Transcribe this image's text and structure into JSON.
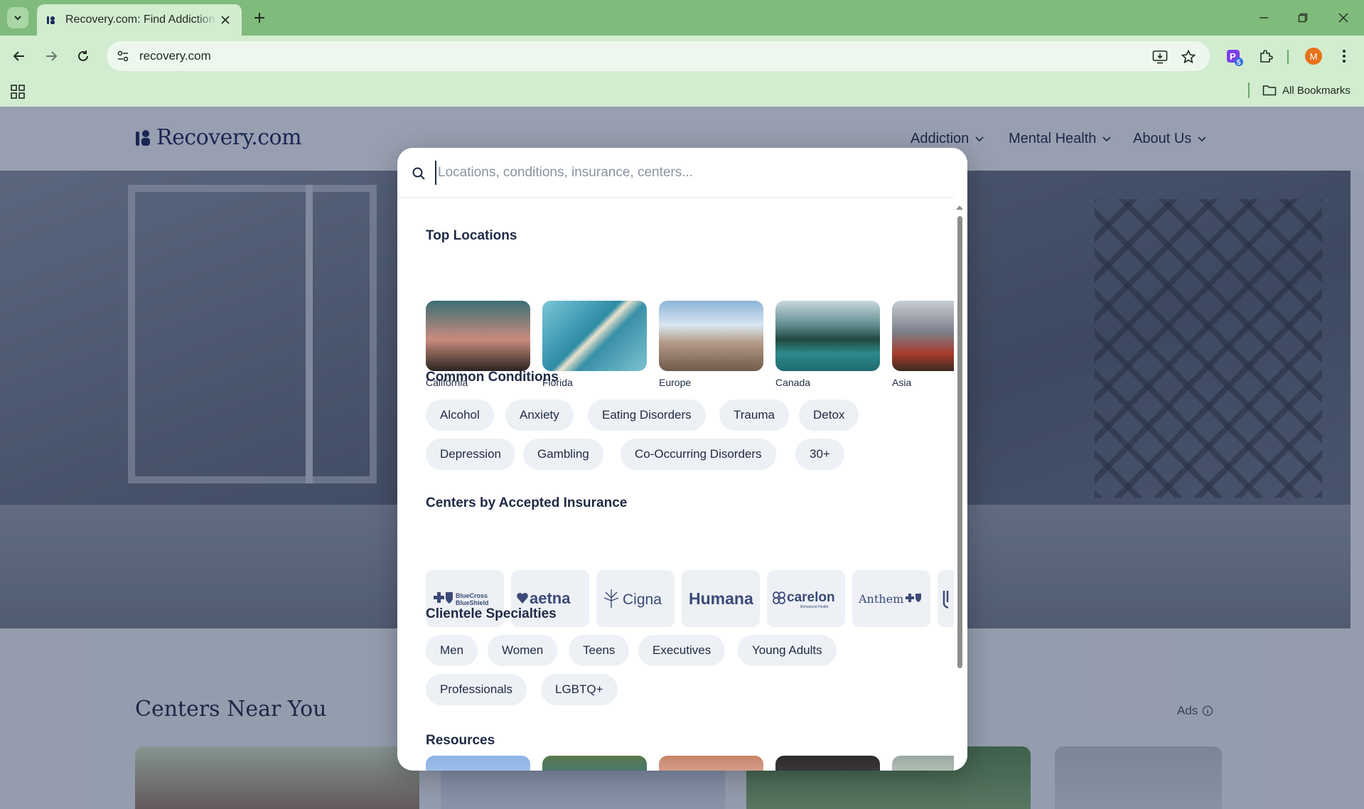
{
  "browser": {
    "tab_title": "Recovery.com: Find Addiction & Mental Health",
    "url": "recovery.com",
    "all_bookmarks_label": "All Bookmarks",
    "profile_initial": "M",
    "extension_badge": "5"
  },
  "site": {
    "logo_text": "Recovery.com",
    "nav": [
      {
        "label": "Addiction"
      },
      {
        "label": "Mental Health"
      },
      {
        "label": "About Us"
      }
    ],
    "centers_title": "Centers Near You",
    "ads_label": "Ads"
  },
  "search": {
    "placeholder": "Locations, conditions, insurance, centers...",
    "value": ""
  },
  "modal": {
    "top_locations_title": "Top Locations",
    "locations": [
      {
        "label": "California"
      },
      {
        "label": "Florida"
      },
      {
        "label": "Europe"
      },
      {
        "label": "Canada"
      },
      {
        "label": "Asia"
      }
    ],
    "conditions_title": "Common Conditions",
    "conditions": [
      "Alcohol",
      "Anxiety",
      "Eating Disorders",
      "Trauma",
      "Detox",
      "Depression",
      "Gambling",
      "Co-Occurring Disorders",
      "30+"
    ],
    "insurance_title": "Centers by Accepted Insurance",
    "insurance": [
      {
        "line1": "BlueCross",
        "line2": "BlueShield"
      },
      {
        "name": "aetna"
      },
      {
        "name": "Cigna"
      },
      {
        "name": "Humana"
      },
      {
        "name": "carelon",
        "sub": "Behavioral Health"
      },
      {
        "name": "Anthem"
      }
    ],
    "clientele_title": "Clientele Specialties",
    "clientele": [
      "Men",
      "Women",
      "Teens",
      "Executives",
      "Young Adults",
      "Professionals",
      "LGBTQ+"
    ],
    "resources_title": "Resources"
  },
  "colors": {
    "tabbar": "#7fbb7b",
    "toolbar": "#d2ecd0",
    "brand_navy": "#1f2a5a",
    "chip_bg": "#edf0f4"
  }
}
